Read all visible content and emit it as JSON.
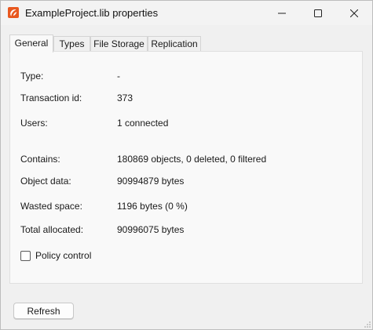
{
  "window": {
    "title": "ExampleProject.lib properties",
    "app_icon": "orange-app-icon",
    "controls": [
      "minimize-icon",
      "maximize-icon",
      "close-icon"
    ]
  },
  "tabs": [
    {
      "label": "General",
      "active": true
    },
    {
      "label": "Types",
      "active": false
    },
    {
      "label": "File Storage",
      "active": false
    },
    {
      "label": "Replication",
      "active": false
    }
  ],
  "general": {
    "type_label": "Type:",
    "type_value": "-",
    "transaction_label": "Transaction id:",
    "transaction_value": "373",
    "users_label": "Users:",
    "users_value": "1 connected",
    "contains_label": "Contains:",
    "contains_value": "180869 objects, 0 deleted, 0 filtered",
    "object_data_label": "Object data:",
    "object_data_value": "90994879 bytes",
    "wasted_label": "Wasted space:",
    "wasted_value": "1196 bytes (0 %)",
    "total_label": "Total allocated:",
    "total_value": "90996075 bytes",
    "policy_label": "Policy control",
    "policy_checked": false
  },
  "footer": {
    "refresh_label": "Refresh"
  },
  "colors": {
    "accent": "#e8581f",
    "window_bg": "#f0f0f0",
    "panel_bg": "#f9f9f9"
  }
}
